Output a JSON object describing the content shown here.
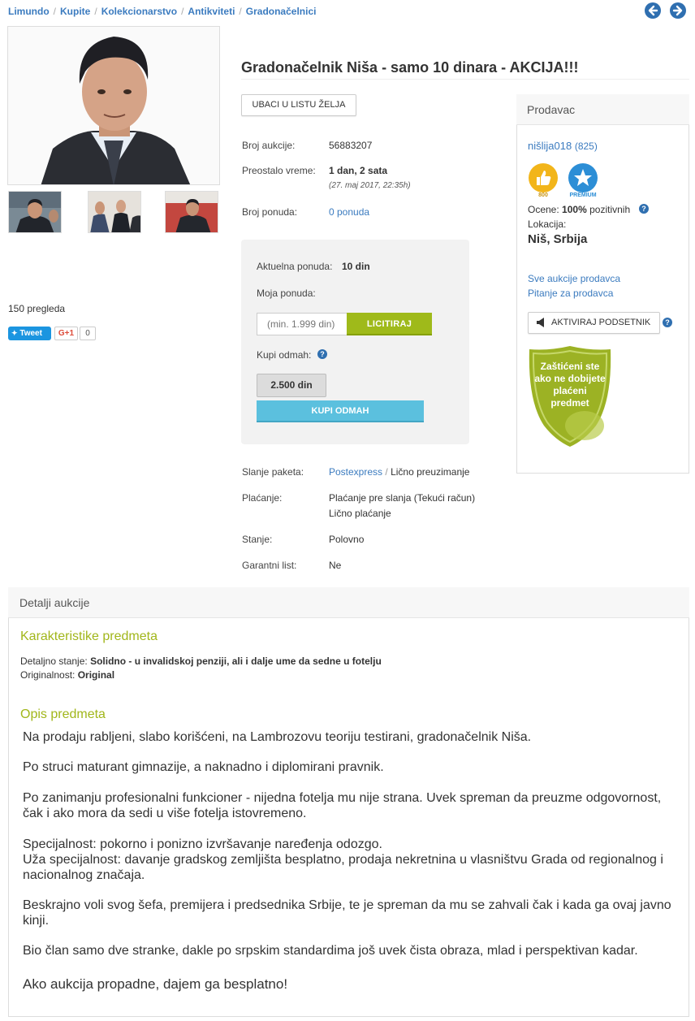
{
  "breadcrumb": {
    "items": [
      "Limundo",
      "Kupite",
      "Kolekcionarstvo",
      "Antikviteti"
    ],
    "current": "Gradonačelnici"
  },
  "icons": {
    "prev": "arrow-left-icon",
    "next": "arrow-right-icon"
  },
  "gallery": {
    "views": "150 pregleda",
    "tweet_label": "Tweet",
    "gplus_label": "G+1",
    "gplus_count": "0"
  },
  "listing": {
    "title": "Gradonačelnik Niša - samo 10 dinara - AKCIJA!!!",
    "wishlist_button": "UBACI U LISTU ŽELJA",
    "auction_number_label": "Broj aukcije:",
    "auction_number": "56883207",
    "time_left_label": "Preostalo vreme:",
    "time_left": "1 dan, 2 sata",
    "end_date": "(27. maj 2017, 22:35h)",
    "bids_label": "Broj ponuda:",
    "bids": "0 ponuda"
  },
  "bid": {
    "current_label": "Aktuelna ponuda:",
    "current_value": "10 din",
    "my_bid_label": "Moja ponuda:",
    "input_placeholder": "(min. 1.999 din)",
    "bid_button": "LICITIRAJ",
    "buy_now_label": "Kupi odmah:",
    "buy_now_price": "2.500 din",
    "buy_now_button": "KUPI ODMAH"
  },
  "shipping": {
    "shipping_label": "Slanje paketa:",
    "shipping_link": "Postexpress",
    "shipping_sep": "/",
    "shipping_other": "Lično preuzimanje",
    "payment_label": "Plaćanje:",
    "payment_1": "Plaćanje pre slanja (Tekući račun)",
    "payment_2": "Lično plaćanje",
    "condition_label": "Stanje:",
    "condition": "Polovno",
    "warranty_label": "Garantni list:",
    "warranty": "Ne"
  },
  "seller": {
    "header": "Prodavac",
    "name": "nišlija018",
    "rating_count": "(825)",
    "badge_1": "800",
    "badge_2": "PREMIUM",
    "ratings_label": "Ocene:",
    "ratings_value": "100%",
    "ratings_suffix": "pozitivnih",
    "location_label": "Lokacija:",
    "location": "Niš, Srbija",
    "all_auctions_link": "Sve aukcije prodavca",
    "question_link": "Pitanje za prodavca",
    "reminder_button": "AKTIVIRAJ PODSETNIK",
    "protection_text": "Zaštićeni ste ako ne dobijete plaćeni predmet"
  },
  "details": {
    "header": "Detalji aukcije",
    "characteristics_title": "Karakteristike predmeta",
    "detail_state_label": "Detaljno stanje:",
    "detail_state": "Solidno - u invalidskoj penziji, ali i dalje ume da sedne u fotelju",
    "originality_label": "Originalnost:",
    "originality": "Original",
    "description_title": "Opis predmeta",
    "paragraphs": [
      "Na prodaju rabljeni, slabo korišćeni, na Lambrozovu teoriju testirani, gradonačelnik Niša.",
      "Po struci maturant gimnazije, a naknadno i diplomirani pravnik.",
      "Po zanimanju profesionalni funkcioner - nijedna fotelja mu nije strana. Uvek spreman da preuzme odgovornost, čak i ako mora da sedi u više fotelja istovremeno.",
      "Specijalnost: pokorno i ponizno izvršavanje naređenja odozgo.",
      "Uža specijalnost: davanje gradskog zemljišta besplatno, prodaja nekretnina u vlasništvu Grada od regionalnog i nacionalnog značaja.",
      "Beskrajno voli svog šefa, premijera i predsednika Srbije, te je spreman da mu se zahvali čak i kada ga ovaj javno kinji.",
      "Bio član samo dve stranke, dakle po srpskim standardima još uvek čista obraza, mlad i perspektivan kadar.",
      "Ako aukcija propadne, dajem ga besplatno!"
    ]
  }
}
